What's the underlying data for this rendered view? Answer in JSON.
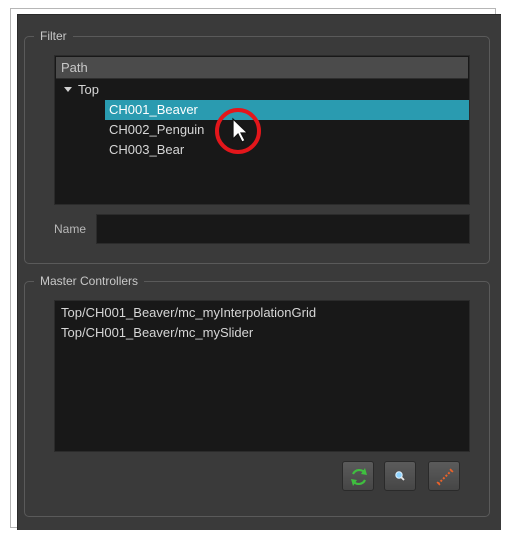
{
  "filter": {
    "title": "Filter",
    "tree": {
      "header": "Path",
      "root": "Top",
      "children": [
        "CH001_Beaver",
        "CH002_Penguin",
        "CH003_Bear"
      ],
      "selected_index": 0
    },
    "name_label": "Name",
    "name_value": ""
  },
  "master_controllers": {
    "title": "Master Controllers",
    "items": [
      "Top/CH001_Beaver/mc_myInterpolationGrid",
      "Top/CH001_Beaver/mc_mySlider"
    ]
  },
  "toolbar": {
    "buttons": [
      {
        "icon": "refresh-icon"
      },
      {
        "icon": "find-icon"
      },
      {
        "icon": "show-slider-icon"
      }
    ]
  },
  "colors": {
    "selection": "#2a9bb0",
    "panel_bg": "#3a3a3a",
    "field_bg": "#181818",
    "highlight_circle": "#e3161b",
    "refresh_green": "#3fbf3f",
    "slider_orange": "#e8622a"
  }
}
